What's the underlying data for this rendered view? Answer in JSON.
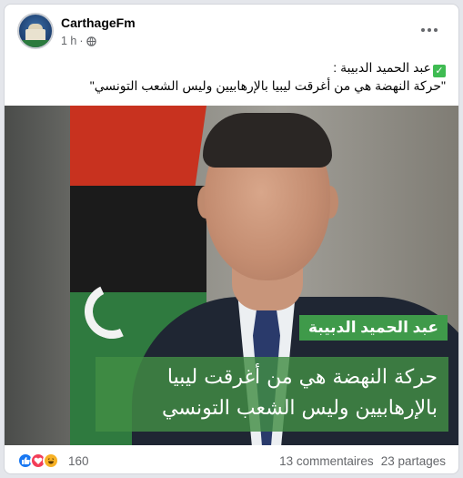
{
  "post": {
    "page_name": "CarthageFm",
    "time": "1 h",
    "separator": "·",
    "caption_line1": "عبد الحميد الدبيبة :",
    "caption_line2": "\"حركة النهضة هي من أغرقت ليبيا بالإرهابيين وليس الشعب التونسي\""
  },
  "image": {
    "name_tag": "عبد الحميد الدبيبة",
    "quote": "حركة النهضة هي من أغرقت ليبيا بالإرهابيين وليس الشعب التونسي"
  },
  "footer": {
    "reaction_count": "160",
    "comments": "13 commentaires",
    "shares": "23 partages"
  },
  "icons": {
    "avatar": "carthagefm-logo",
    "privacy": "globe-icon",
    "menu": "more-icon",
    "caption_emoji": "check-mark-icon",
    "reactions": [
      "like-icon",
      "love-icon",
      "haha-icon"
    ]
  },
  "colors": {
    "caption_check": "#3fbb52",
    "overlay_green": "#3f9a4a",
    "like": "#1877f2",
    "love": "#f33e58",
    "haha": "#f7b125"
  }
}
